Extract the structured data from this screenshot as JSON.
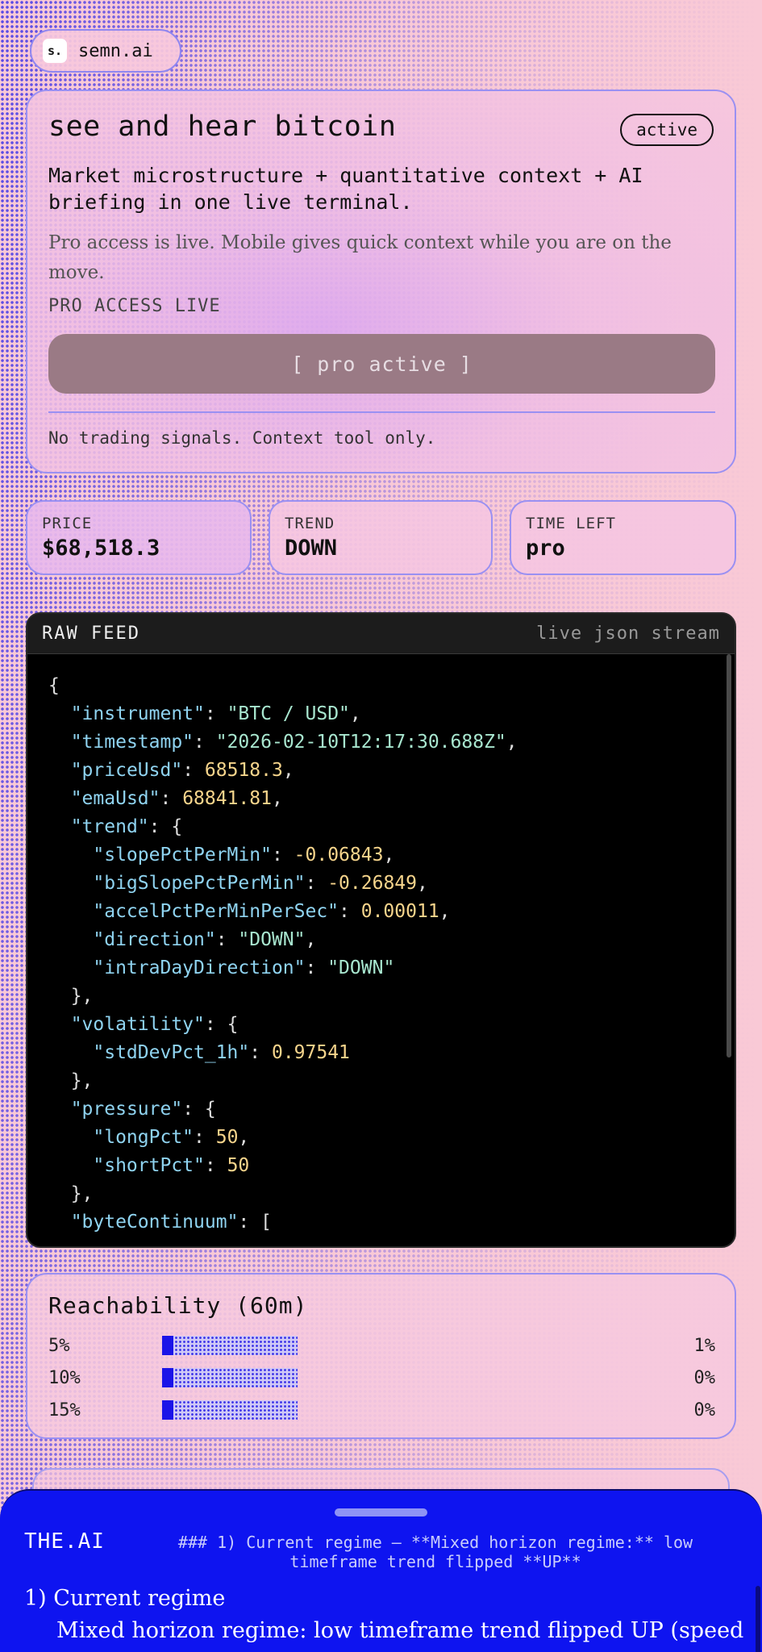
{
  "brand": {
    "logo": "s.",
    "name": "semn.ai"
  },
  "hero": {
    "title": "see and hear bitcoin",
    "badge": "active",
    "subtitle": "Market microstructure + quantitative context + AI briefing in one live terminal.",
    "description": "Pro access is live. Mobile gives quick context while you are on the move.",
    "status": "PRO ACCESS LIVE",
    "button": "[ pro active ]",
    "note": "No trading signals. Context tool only."
  },
  "stats": [
    {
      "label": "PRICE",
      "value": "$68,518.3"
    },
    {
      "label": "TREND",
      "value": "DOWN"
    },
    {
      "label": "TIME LEFT",
      "value": "pro"
    }
  ],
  "feed": {
    "title": "RAW FEED",
    "tag": "live json stream",
    "lines": [
      [
        [
          "p",
          "{"
        ]
      ],
      [
        [
          "p",
          "  "
        ],
        [
          "k",
          "\"instrument\""
        ],
        [
          "p",
          ": "
        ],
        [
          "s",
          "\"BTC / USD\""
        ],
        [
          "p",
          ","
        ]
      ],
      [
        [
          "p",
          "  "
        ],
        [
          "k",
          "\"timestamp\""
        ],
        [
          "p",
          ": "
        ],
        [
          "s",
          "\"2026-02-10T12:17:30.688Z\""
        ],
        [
          "p",
          ","
        ]
      ],
      [
        [
          "p",
          "  "
        ],
        [
          "k",
          "\"priceUsd\""
        ],
        [
          "p",
          ": "
        ],
        [
          "n",
          "68518.3"
        ],
        [
          "p",
          ","
        ]
      ],
      [
        [
          "p",
          "  "
        ],
        [
          "k",
          "\"emaUsd\""
        ],
        [
          "p",
          ": "
        ],
        [
          "n",
          "68841.81"
        ],
        [
          "p",
          ","
        ]
      ],
      [
        [
          "p",
          "  "
        ],
        [
          "k",
          "\"trend\""
        ],
        [
          "p",
          ": {"
        ]
      ],
      [
        [
          "p",
          "    "
        ],
        [
          "k",
          "\"slopePctPerMin\""
        ],
        [
          "p",
          ": "
        ],
        [
          "n",
          "-0.06843"
        ],
        [
          "p",
          ","
        ]
      ],
      [
        [
          "p",
          "    "
        ],
        [
          "k",
          "\"bigSlopePctPerMin\""
        ],
        [
          "p",
          ": "
        ],
        [
          "n",
          "-0.26849"
        ],
        [
          "p",
          ","
        ]
      ],
      [
        [
          "p",
          "    "
        ],
        [
          "k",
          "\"accelPctPerMinPerSec\""
        ],
        [
          "p",
          ": "
        ],
        [
          "n",
          "0.00011"
        ],
        [
          "p",
          ","
        ]
      ],
      [
        [
          "p",
          "    "
        ],
        [
          "k",
          "\"direction\""
        ],
        [
          "p",
          ": "
        ],
        [
          "s",
          "\"DOWN\""
        ],
        [
          "p",
          ","
        ]
      ],
      [
        [
          "p",
          "    "
        ],
        [
          "k",
          "\"intraDayDirection\""
        ],
        [
          "p",
          ": "
        ],
        [
          "s",
          "\"DOWN\""
        ]
      ],
      [
        [
          "p",
          "  },"
        ]
      ],
      [
        [
          "p",
          "  "
        ],
        [
          "k",
          "\"volatility\""
        ],
        [
          "p",
          ": {"
        ]
      ],
      [
        [
          "p",
          "    "
        ],
        [
          "k",
          "\"stdDevPct_1h\""
        ],
        [
          "p",
          ": "
        ],
        [
          "n",
          "0.97541"
        ]
      ],
      [
        [
          "p",
          "  },"
        ]
      ],
      [
        [
          "p",
          "  "
        ],
        [
          "k",
          "\"pressure\""
        ],
        [
          "p",
          ": {"
        ]
      ],
      [
        [
          "p",
          "    "
        ],
        [
          "k",
          "\"longPct\""
        ],
        [
          "p",
          ": "
        ],
        [
          "n",
          "50"
        ],
        [
          "p",
          ","
        ]
      ],
      [
        [
          "p",
          "    "
        ],
        [
          "k",
          "\"shortPct\""
        ],
        [
          "p",
          ": "
        ],
        [
          "n",
          "50"
        ]
      ],
      [
        [
          "p",
          "  },"
        ]
      ],
      [
        [
          "p",
          "  "
        ],
        [
          "k",
          "\"byteContinuum\""
        ],
        [
          "p",
          ": ["
        ]
      ],
      [
        [
          "p",
          "    \" \""
        ]
      ]
    ]
  },
  "reachability": {
    "title": "Reachability (60m)",
    "rows": [
      {
        "label": "5%",
        "value": "1%",
        "fill": 0.01
      },
      {
        "label": "10%",
        "value": "0%",
        "fill": 0.0
      },
      {
        "label": "15%",
        "value": "0%",
        "fill": 0.0
      }
    ]
  },
  "ai": {
    "label": "THE.AI",
    "raw": "### 1) Current regime — **Mixed horizon regime:** low timeframe trend flipped **UP**",
    "heading": "1) Current regime",
    "text": "Mixed horizon regime: low timeframe trend flipped UP (speed"
  },
  "colors": {
    "accent": "#1b14e8",
    "background": "#f9c9d6",
    "border": "#9a90f2"
  }
}
